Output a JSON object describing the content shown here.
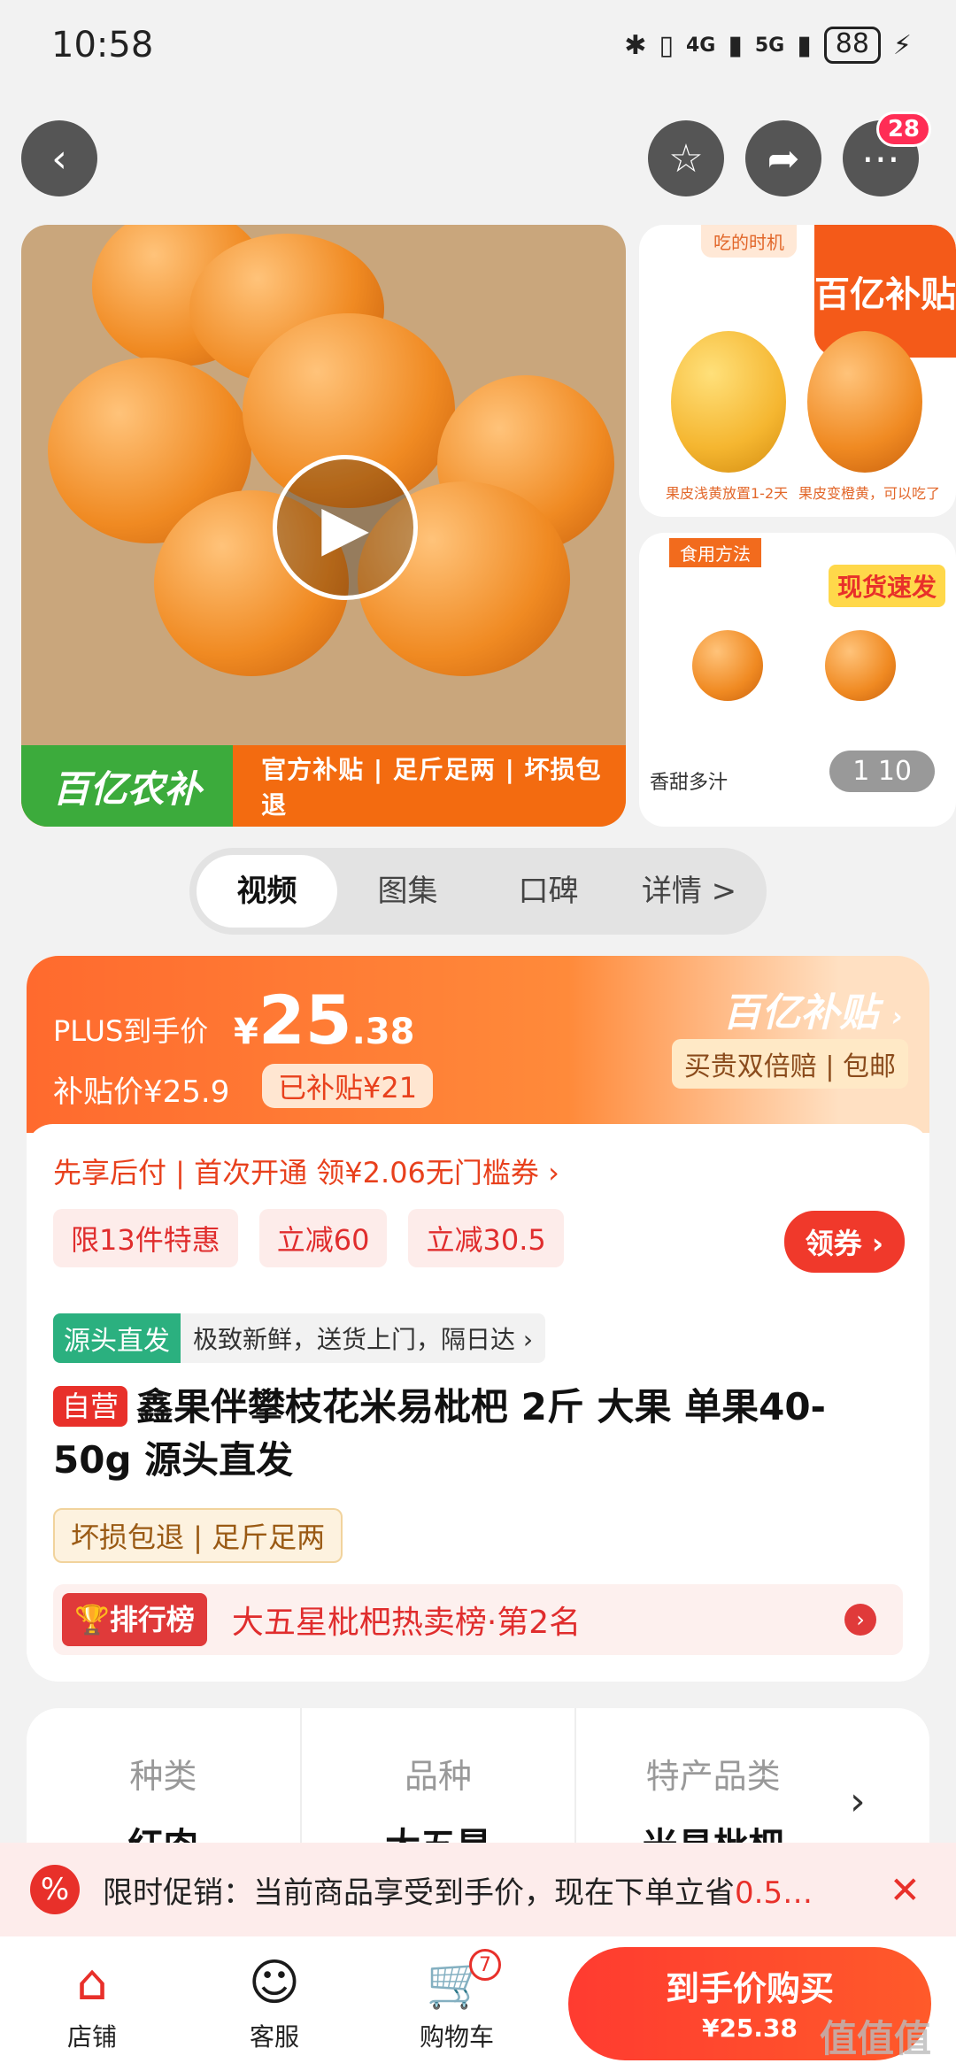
{
  "status_bar": {
    "time": "10:58",
    "network1": "4G",
    "network2": "5G",
    "battery": "88"
  },
  "top_nav": {
    "more_badge": "28"
  },
  "gallery": {
    "banner_logo": "百亿农补",
    "banner_tags": "官方补贴 | 足斤足两 | 坏损包退",
    "counter": "1 10",
    "thumb_tag": "香甜多汁",
    "thumb1_title": "吃的时机",
    "thumb1_badge": "百亿补贴",
    "thumb1_caption_left": "果皮浅黄放置1-2天",
    "thumb1_caption_right": "果皮变橙黄，可以吃了",
    "thumb2_title": "食用方法",
    "thumb2_badge": "现货速发"
  },
  "tabs": [
    "视频",
    "图集",
    "口碑",
    "详情 >"
  ],
  "price": {
    "plus_label": "PLUS到手价",
    "yen": "¥",
    "int": "25",
    "dec": ".38",
    "sub_price": "补贴价¥25.9",
    "sub_badge": "已补贴¥21",
    "brand": "百亿补贴",
    "brand_tag": "买贵双倍赔 | 包邮"
  },
  "offers": {
    "pay_later": "先享后付 | 首次开通 领¥2.06无门槛券 ›",
    "chips": [
      "限13件特惠",
      "立减60",
      "立减30.5"
    ],
    "coupon_button": "领券"
  },
  "source": {
    "tag": "源头直发",
    "text": "极致新鲜，送货上门，隔日达 ›"
  },
  "product": {
    "self_tag": "自营",
    "title": "鑫果伴攀枝花米易枇杷 2斤 大果 单果40-50g 源头直发",
    "guarantee": "坏损包退 | 足斤足两"
  },
  "ranking": {
    "tag": "排行榜",
    "text": "大五星枇杷热卖榜·第2名"
  },
  "attributes": [
    {
      "key": "种类",
      "value": "红肉"
    },
    {
      "key": "品种",
      "value": "大五星"
    },
    {
      "key": "特产品类",
      "value": "米易枇杷"
    }
  ],
  "promo": {
    "text": "限时促销：当前商品享受到手价，现在下单立省",
    "highlight": "0.5…"
  },
  "bottom_nav": {
    "shop": "店铺",
    "service": "客服",
    "cart": "购物车",
    "cart_count": "7",
    "buy_line1": "到手价购买",
    "buy_line2": "¥25.38"
  },
  "watermark": "值值值"
}
